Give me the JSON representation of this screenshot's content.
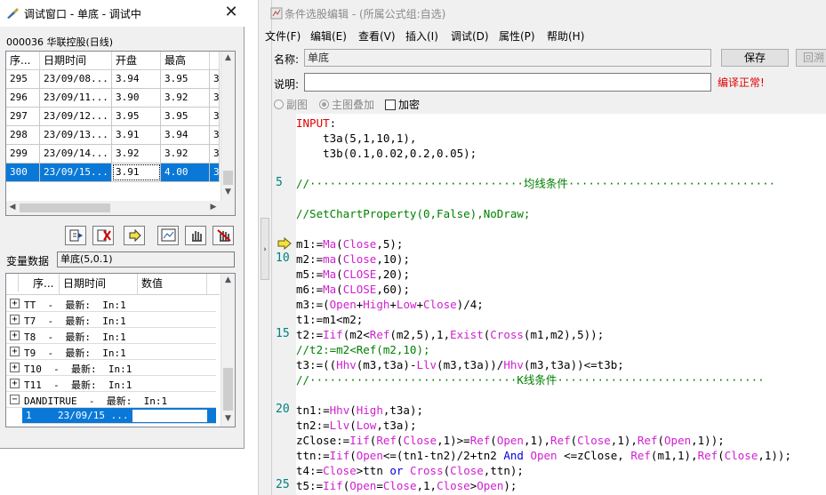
{
  "debug_window": {
    "title": "调试窗口 - 单底 - 调试中",
    "stock_label": "000036 华联控股(日线)",
    "price_table": {
      "headers": [
        "序...",
        "日期时间",
        "开盘",
        "最高",
        ""
      ],
      "rows": [
        [
          "295",
          "23/09/08...",
          "3.94",
          "3.95",
          "3"
        ],
        [
          "296",
          "23/09/11...",
          "3.90",
          "3.92",
          "3"
        ],
        [
          "297",
          "23/09/12...",
          "3.95",
          "3.95",
          "3"
        ],
        [
          "298",
          "23/09/13...",
          "3.91",
          "3.94",
          "3"
        ],
        [
          "299",
          "23/09/14...",
          "3.92",
          "3.92",
          "3"
        ],
        [
          "300",
          "23/09/15...",
          "3.91",
          "4.00",
          "3"
        ]
      ]
    },
    "toolbar_icons": [
      "step-icon",
      "stop-debug-icon",
      "run-arrow-icon",
      "chart-icon",
      "hand-icon",
      "hand-stop-icon"
    ],
    "var_label": "变量数据",
    "var_value": "单底(5,0.1)",
    "var_table": {
      "headers": [
        "序...",
        "日期时间",
        "数值"
      ],
      "rows": [
        {
          "sign": "+",
          "text": "TT  -  最新:  In:1"
        },
        {
          "sign": "+",
          "text": "T7  -  最新:  In:1"
        },
        {
          "sign": "+",
          "text": "T8  -  最新:  In:1"
        },
        {
          "sign": "+",
          "text": "T9  -  最新:  In:1"
        },
        {
          "sign": "+",
          "text": "T10  -  最新:  In:1"
        },
        {
          "sign": "+",
          "text": "T11  -  最新:  In:1"
        },
        {
          "sign": "−",
          "text": "DANDITRUE  -  最新:  In:1"
        }
      ],
      "child_row": [
        "1",
        "23/09/15 ...",
        ""
      ]
    }
  },
  "editor": {
    "title": "条件选股编辑 - (所属公式组:自选)",
    "menu": [
      "文件(F)",
      "编辑(E)",
      "查看(V)",
      "插入(I)",
      "调试(D)",
      "属性(P)",
      "帮助(H)"
    ],
    "name_label": "名称:",
    "name_value": "单底",
    "save_label": "保存",
    "back_label": "回溯",
    "desc_label": "说明:",
    "desc_value": "",
    "compile_status": "编译正常!",
    "options": {
      "sub_chart": "副图",
      "main_overlay": "主图叠加",
      "encrypt": "加密"
    },
    "line_numbers": [
      "5",
      "10",
      "15",
      "20",
      "25"
    ],
    "code_lines": [
      [
        [
          "kw",
          "INPUT"
        ],
        [
          "nm",
          ":"
        ]
      ],
      [
        [
          "nm",
          "    t3a(5,1,10,1),"
        ]
      ],
      [
        [
          "nm",
          "    t3b(0.1,0.02,0.2,0.05);"
        ]
      ],
      [
        [
          "nm",
          ""
        ]
      ],
      [
        [
          "cm",
          "//································均线条件·······························"
        ]
      ],
      [
        [
          "nm",
          ""
        ]
      ],
      [
        [
          "cm",
          "//SetChartProperty(0,False),NoDraw;"
        ]
      ],
      [
        [
          "nm",
          ""
        ]
      ],
      [
        [
          "nm",
          "m1:="
        ],
        [
          "fn",
          "Ma"
        ],
        [
          "nm",
          "("
        ],
        [
          "fn",
          "Close"
        ],
        [
          "nm",
          ",5);"
        ]
      ],
      [
        [
          "nm",
          "m2:="
        ],
        [
          "fn",
          "ma"
        ],
        [
          "nm",
          "("
        ],
        [
          "fn",
          "Close"
        ],
        [
          "nm",
          ",10);"
        ]
      ],
      [
        [
          "nm",
          "m5:="
        ],
        [
          "fn",
          "Ma"
        ],
        [
          "nm",
          "("
        ],
        [
          "fn",
          "CLOSE"
        ],
        [
          "nm",
          ",20);"
        ]
      ],
      [
        [
          "nm",
          "m6:="
        ],
        [
          "fn",
          "Ma"
        ],
        [
          "nm",
          "("
        ],
        [
          "fn",
          "CLOSE"
        ],
        [
          "nm",
          ",60);"
        ]
      ],
      [
        [
          "nm",
          "m3:=("
        ],
        [
          "fn",
          "Open"
        ],
        [
          "nm",
          "+"
        ],
        [
          "fn",
          "High"
        ],
        [
          "nm",
          "+"
        ],
        [
          "fn",
          "Low"
        ],
        [
          "nm",
          "+"
        ],
        [
          "fn",
          "Close"
        ],
        [
          "nm",
          ")/4;"
        ]
      ],
      [
        [
          "nm",
          "t1:=m1<m2;"
        ]
      ],
      [
        [
          "nm",
          "t2:="
        ],
        [
          "fn",
          "Iif"
        ],
        [
          "nm",
          "(m2<"
        ],
        [
          "fn",
          "Ref"
        ],
        [
          "nm",
          "(m2,5),1,"
        ],
        [
          "fn",
          "Exist"
        ],
        [
          "nm",
          "("
        ],
        [
          "fn",
          "Cross"
        ],
        [
          "nm",
          "(m1,m2),5));"
        ]
      ],
      [
        [
          "cm",
          "//t2:=m2<Ref(m2,10);"
        ]
      ],
      [
        [
          "nm",
          "t3:=(("
        ],
        [
          "fn",
          "Hhv"
        ],
        [
          "nm",
          "(m3,t3a)-"
        ],
        [
          "fn",
          "Llv"
        ],
        [
          "nm",
          "(m3,t3a))/"
        ],
        [
          "fn",
          "Hhv"
        ],
        [
          "nm",
          "(m3,t3a))<=t3b;"
        ]
      ],
      [
        [
          "cm",
          "//·······························K线条件·······························"
        ]
      ],
      [
        [
          "nm",
          ""
        ]
      ],
      [
        [
          "nm",
          "tn1:="
        ],
        [
          "fn",
          "Hhv"
        ],
        [
          "nm",
          "("
        ],
        [
          "fn",
          "High"
        ],
        [
          "nm",
          ",t3a);"
        ]
      ],
      [
        [
          "nm",
          "tn2:="
        ],
        [
          "fn",
          "Llv"
        ],
        [
          "nm",
          "("
        ],
        [
          "fn",
          "Low"
        ],
        [
          "nm",
          ",t3a);"
        ]
      ],
      [
        [
          "nm",
          "zClose:="
        ],
        [
          "fn",
          "Iif"
        ],
        [
          "nm",
          "("
        ],
        [
          "fn",
          "Ref"
        ],
        [
          "nm",
          "("
        ],
        [
          "fn",
          "Close"
        ],
        [
          "nm",
          ",1)>="
        ],
        [
          "fn",
          "Ref"
        ],
        [
          "nm",
          "("
        ],
        [
          "fn",
          "Open"
        ],
        [
          "nm",
          ",1),"
        ],
        [
          "fn",
          "Ref"
        ],
        [
          "nm",
          "("
        ],
        [
          "fn",
          "Close"
        ],
        [
          "nm",
          ",1),"
        ],
        [
          "fn",
          "Ref"
        ],
        [
          "nm",
          "("
        ],
        [
          "fn",
          "Open"
        ],
        [
          "nm",
          ",1));"
        ]
      ],
      [
        [
          "nm",
          "ttn:="
        ],
        [
          "fn",
          "Iif"
        ],
        [
          "nm",
          "("
        ],
        [
          "fn",
          "Open"
        ],
        [
          "nm",
          "<=(tn1-tn2)/2+tn2 "
        ],
        [
          "bl",
          "And"
        ],
        [
          "nm",
          " "
        ],
        [
          "fn",
          "Open"
        ],
        [
          "nm",
          " <=zClose, "
        ],
        [
          "fn",
          "Ref"
        ],
        [
          "nm",
          "(m1,1),"
        ],
        [
          "fn",
          "Ref"
        ],
        [
          "nm",
          "("
        ],
        [
          "fn",
          "Close"
        ],
        [
          "nm",
          ",1));"
        ]
      ],
      [
        [
          "nm",
          "t4:="
        ],
        [
          "fn",
          "Close"
        ],
        [
          "nm",
          ">ttn "
        ],
        [
          "bl",
          "or"
        ],
        [
          "nm",
          " "
        ],
        [
          "fn",
          "Cross"
        ],
        [
          "nm",
          "("
        ],
        [
          "fn",
          "Close"
        ],
        [
          "nm",
          ",ttn);"
        ]
      ],
      [
        [
          "nm",
          "t5:="
        ],
        [
          "fn",
          "Iif"
        ],
        [
          "nm",
          "("
        ],
        [
          "fn",
          "Open"
        ],
        [
          "nm",
          "="
        ],
        [
          "fn",
          "Close"
        ],
        [
          "nm",
          ",1,"
        ],
        [
          "fn",
          "Close"
        ],
        [
          "nm",
          ">"
        ],
        [
          "fn",
          "Open"
        ],
        [
          "nm",
          ");"
        ]
      ]
    ]
  }
}
